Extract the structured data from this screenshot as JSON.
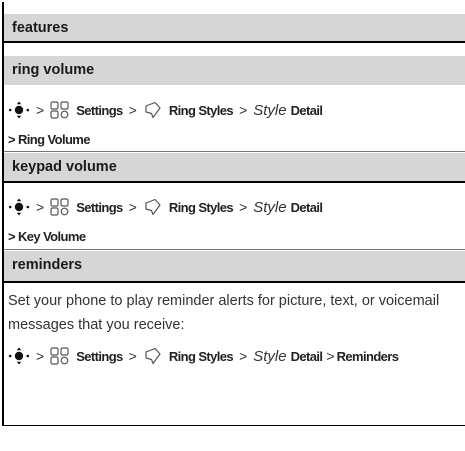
{
  "table": {
    "header": "features",
    "sections": [
      {
        "title": "ring volume",
        "path1": {
          "settings": "Settings",
          "ring_styles": "Ring Styles",
          "style": "Style",
          "detail": "Detail"
        },
        "path2": "> Ring Volume"
      },
      {
        "title": "keypad volume",
        "path1": {
          "settings": "Settings",
          "ring_styles": "Ring Styles",
          "style": "Style",
          "detail": "Detail"
        },
        "path2": "> Key Volume"
      },
      {
        "title": "reminders",
        "description": "Set your phone to play reminder alerts for picture, text, or voicemail messages that you receive:",
        "path1": {
          "settings": "Settings",
          "ring_styles": "Ring Styles",
          "style": "Style",
          "detail": "Detail",
          "tail": "Reminders"
        }
      }
    ],
    "separator": ">"
  }
}
